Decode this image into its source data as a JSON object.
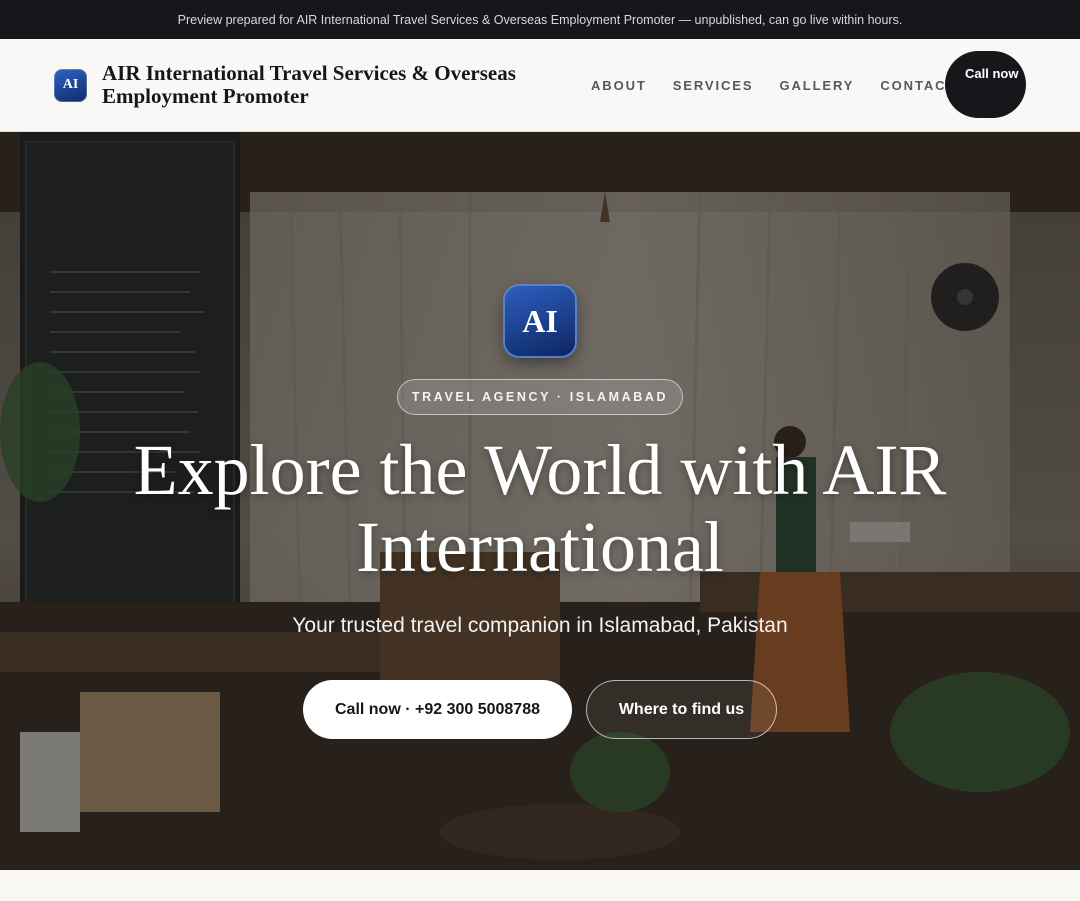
{
  "preview_bar": {
    "text": "Preview prepared for AIR International Travel Services & Overseas Employment Promoter — unpublished, can go live within hours."
  },
  "header": {
    "logo_text": "AI",
    "brand_name": "AIR International Travel Services & Overseas Employment Promoter",
    "nav": [
      "ABOUT",
      "SERVICES",
      "GALLERY",
      "CONTACT"
    ],
    "call_button": "Call now"
  },
  "hero": {
    "logo_text": "AI",
    "tag": "TRAVEL AGENCY · ISLAMABAD",
    "title": "Explore the World with AIR International",
    "subtitle": "Your trusted travel companion in Islamabad, Pakistan",
    "primary_button": "Call now · +92 300 5008788",
    "secondary_button": "Where to find us",
    "background_image": "shop-interior-photo"
  },
  "colors": {
    "dark": "#15171b",
    "logo_blue": "#1f4aa5",
    "nav_text": "#55585e",
    "background": "#f8f7f4"
  }
}
